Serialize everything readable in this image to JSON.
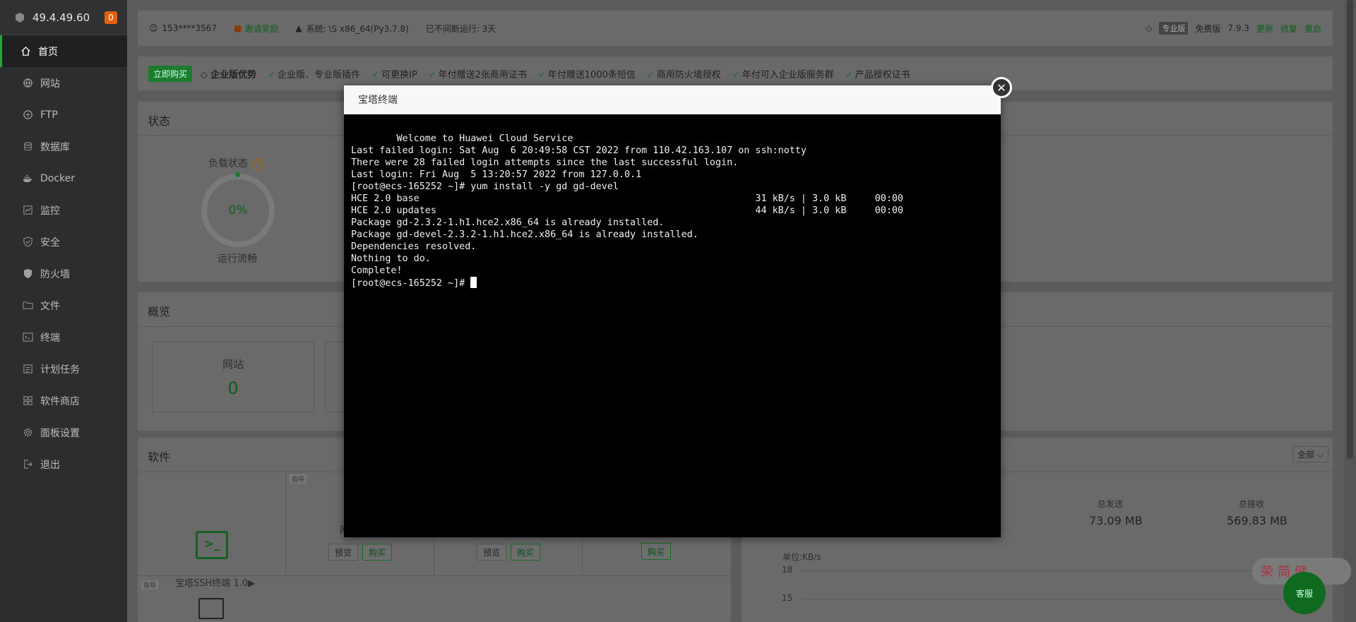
{
  "sidebar": {
    "ip": "49.4.49.60",
    "badge": "0",
    "items": [
      {
        "label": "首页",
        "icon": "home-icon"
      },
      {
        "label": "网站",
        "icon": "globe-icon"
      },
      {
        "label": "FTP",
        "icon": "ftp-icon"
      },
      {
        "label": "数据库",
        "icon": "database-icon"
      },
      {
        "label": "Docker",
        "icon": "docker-icon"
      },
      {
        "label": "监控",
        "icon": "monitor-icon"
      },
      {
        "label": "安全",
        "icon": "shield-check-icon"
      },
      {
        "label": "防火墙",
        "icon": "shield-icon"
      },
      {
        "label": "文件",
        "icon": "folder-icon"
      },
      {
        "label": "终端",
        "icon": "terminal-icon"
      },
      {
        "label": "计划任务",
        "icon": "calendar-icon"
      },
      {
        "label": "软件商店",
        "icon": "apps-icon"
      },
      {
        "label": "面板设置",
        "icon": "gear-icon"
      },
      {
        "label": "退出",
        "icon": "logout-icon"
      }
    ]
  },
  "topbar": {
    "user": "153****3567",
    "invite": "邀请奖励",
    "system": "系统:  \\S x86_64(Py3.7.8)",
    "uptime": "已不间断运行: 3天",
    "pro_tag": "专业版",
    "edition": "免费版",
    "version": "7.9.3",
    "update": "更新",
    "repair": "修复",
    "restart": "重启"
  },
  "promo": {
    "buy": "立即购买",
    "title": "企业版优势",
    "items": [
      "企业版、专业版插件",
      "可更换IP",
      "年付赠送2张商用证书",
      "年付赠送1000条短信",
      "商用防火墙授权",
      "年付可入企业版服务群",
      "产品授权证书"
    ]
  },
  "status": {
    "title": "状态",
    "load_label": "负载状态",
    "help": "?",
    "load_value": "0%",
    "load_text": "运行流畅"
  },
  "overview": {
    "title": "概览",
    "site_label": "网站",
    "site_count": "0"
  },
  "software": {
    "title": "软件",
    "pin": "指导",
    "ssh_name": "宝塔SSH终端 1.0▶",
    "preview": "预览",
    "buy": "购买",
    "partial": "网"
  },
  "network": {
    "filter": "全部 ⌵",
    "sent_label": "总发送",
    "sent_value": "73.09 MB",
    "recv_label": "总接收",
    "recv_value": "569.83 MB",
    "unit": "单位:KB/s",
    "y1": "18",
    "y2": "15"
  },
  "kefu": "客服",
  "mascot": "荣简健",
  "modal": {
    "title": "宝塔终端",
    "close": "✕",
    "lines": [
      "        Welcome to Huawei Cloud Service",
      "",
      "Last failed login: Sat Aug  6 20:49:58 CST 2022 from 110.42.163.107 on ssh:notty",
      "There were 28 failed login attempts since the last successful login.",
      "Last login: Fri Aug  5 13:20:57 2022 from 127.0.0.1",
      "[root@ecs-165252 ~]# yum install -y gd gd-devel",
      "HCE 2.0 base                                                           31 kB/s | 3.0 kB     00:00",
      "HCE 2.0 updates                                                        44 kB/s | 3.0 kB     00:00",
      "Package gd-2.3.2-1.h1.hce2.x86_64 is already installed.",
      "Package gd-devel-2.3.2-1.h1.hce2.x86_64 is already installed.",
      "Dependencies resolved.",
      "Nothing to do.",
      "Complete!"
    ],
    "prompt": "[root@ecs-165252 ~]# "
  }
}
